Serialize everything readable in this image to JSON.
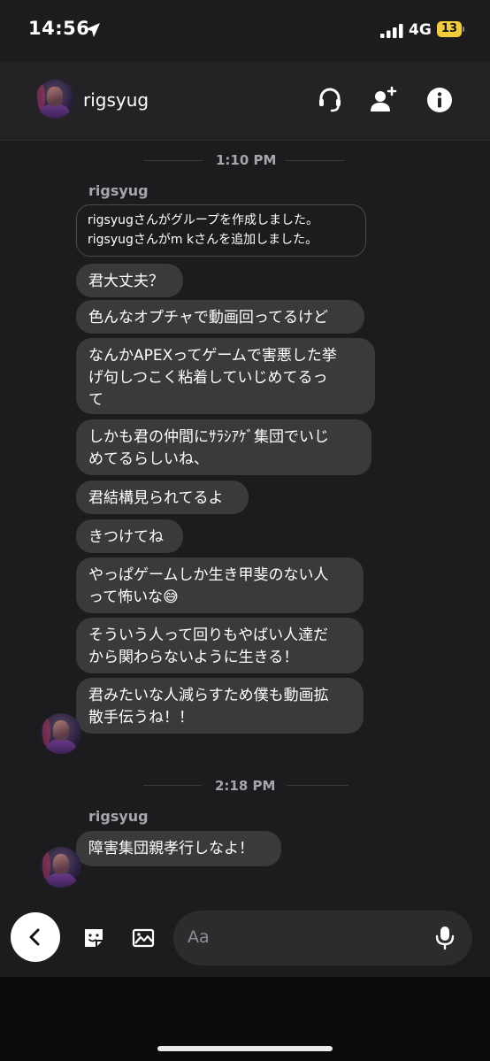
{
  "status_bar": {
    "time": "14:56",
    "network": "4G",
    "battery": "13"
  },
  "header": {
    "contact_name": "rigsyug"
  },
  "thread": {
    "groups": [
      {
        "timestamp": "1:10 PM",
        "sender": "rigsyug",
        "system_message": "rigsyugさんがグループを作成しました。\nrigsyugさんがm kさんを追加しました。",
        "messages": [
          "君大丈夫？",
          "色んなオプチャで動画回ってるけど",
          "なんかAPEXってゲームで害悪した挙\nげ句しつこく粘着していじめてるっ\nて",
          "しかも君の仲間にｻﾗｼｱｹﾞ集団でいじ\nめてるらしいね、",
          "君結構見られてるよ",
          "きつけてね",
          "やっぱゲームしか生き甲斐のない人\nって怖いな😅",
          "そういう人って回りもやばい人達だ\nから関わらないように生きる！",
          "君みたいな人減らすため僕も動画拡\n散手伝うね！！"
        ]
      },
      {
        "timestamp": "2:18 PM",
        "sender": "rigsyug",
        "messages": [
          "障害集団親孝行しなよ！"
        ]
      }
    ]
  },
  "composer": {
    "placeholder": "Aa"
  },
  "icons": [
    "back-arrow-icon",
    "headset-icon",
    "add-person-icon",
    "info-icon",
    "sticker-icon",
    "image-icon",
    "microphone-icon",
    "location-arrow-icon",
    "signal-icon"
  ]
}
